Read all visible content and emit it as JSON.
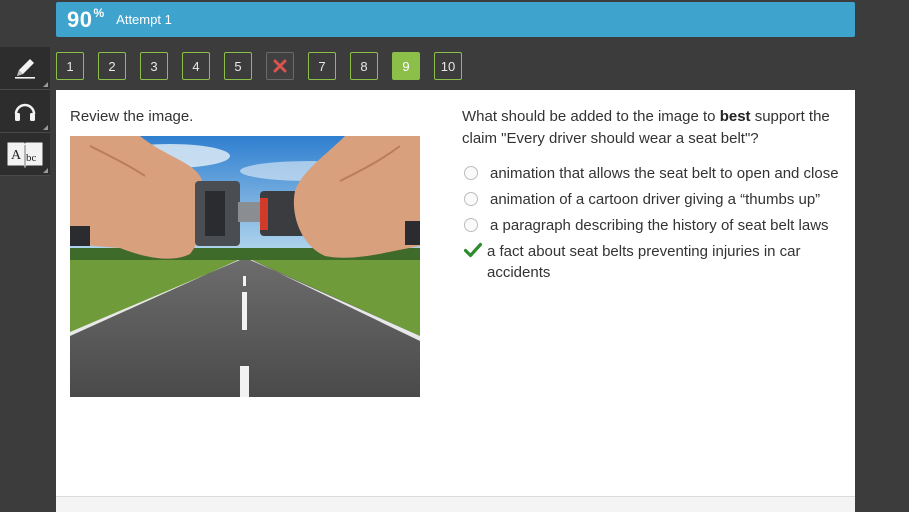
{
  "score": {
    "value": "90",
    "unit": "%",
    "attempt_label": "Attempt 1"
  },
  "tools": [
    {
      "name": "pencil-icon"
    },
    {
      "name": "headphones-icon"
    },
    {
      "name": "dictionary-icon",
      "glyph": "Abc"
    }
  ],
  "nav": {
    "items": [
      {
        "label": "1",
        "state": "answered"
      },
      {
        "label": "2",
        "state": "answered"
      },
      {
        "label": "3",
        "state": "answered"
      },
      {
        "label": "4",
        "state": "answered"
      },
      {
        "label": "5",
        "state": "answered"
      },
      {
        "label": "",
        "state": "incorrect",
        "icon": "x-icon"
      },
      {
        "label": "7",
        "state": "answered"
      },
      {
        "label": "8",
        "state": "answered"
      },
      {
        "label": "9",
        "state": "current"
      },
      {
        "label": "10",
        "state": "answered"
      }
    ]
  },
  "content": {
    "review_text": "Review the image.",
    "question_prefix": "What should be added to the image to ",
    "question_bold": "best",
    "question_suffix": " support the claim \"Every driver should wear a seat belt\"?",
    "options": [
      {
        "label": "animation that allows the seat belt to open and close",
        "selected": false
      },
      {
        "label": "animation of a cartoon driver giving a “thumbs up”",
        "selected": false
      },
      {
        "label": "a paragraph describing the history of seat belt laws",
        "selected": false
      },
      {
        "label": "a fact about seat belts preventing injuries in car accidents",
        "selected": true
      }
    ]
  },
  "colors": {
    "accent": "#3fa4cd",
    "correct": "#8cbf4a",
    "checkmark": "#2e8b2e",
    "wrong": "#d9534f"
  }
}
